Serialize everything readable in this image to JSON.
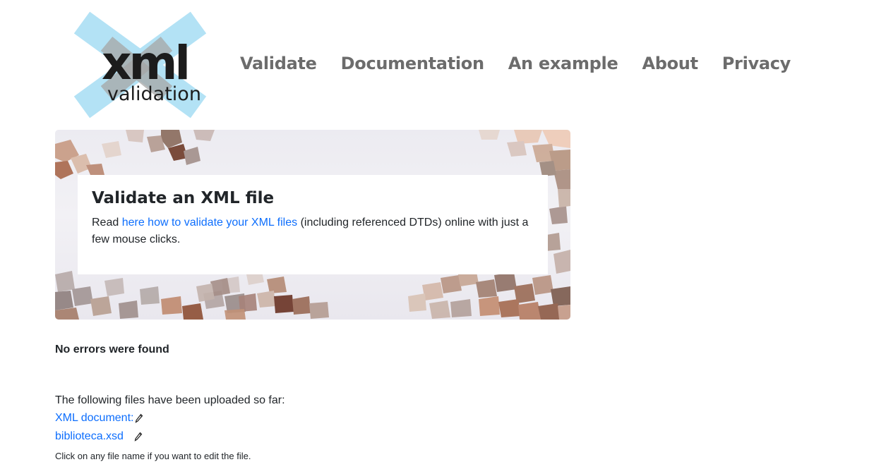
{
  "logo": {
    "word_main": "xml",
    "word_sub": "validation"
  },
  "nav": [
    {
      "label": "Validate"
    },
    {
      "label": "Documentation"
    },
    {
      "label": "An example"
    },
    {
      "label": "About"
    },
    {
      "label": "Privacy"
    }
  ],
  "hero": {
    "title": "Validate an XML file",
    "text_before": "Read ",
    "link_text": "here how to validate your XML files",
    "text_after": " (including referenced DTDs) online with just a few mouse clicks."
  },
  "result": "No errors were found",
  "files": {
    "intro": "The following files have been uploaded so far:",
    "items": [
      {
        "label": "XML document:"
      },
      {
        "label": "biblioteca.xsd"
      }
    ],
    "note": "Click on any file name if you want to edit the file."
  },
  "colors": {
    "link": "#0d6efd",
    "nav": "#6c6c6c",
    "logo_x": "#b3e2f5"
  }
}
